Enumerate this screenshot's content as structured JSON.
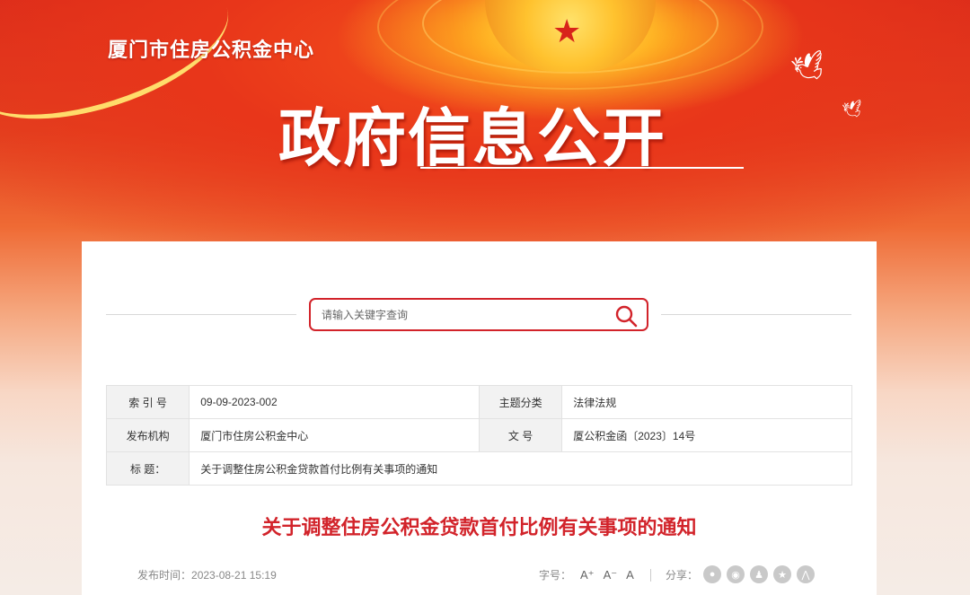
{
  "header": {
    "org_title": "厦门市住房公积金中心",
    "main_title": "政府信息公开"
  },
  "search": {
    "placeholder": "请输入关键字查询"
  },
  "meta_table": {
    "index_label": "索 引 号",
    "index_value": "09-09-2023-002",
    "topic_label": "主题分类",
    "topic_value": "法律法规",
    "issuer_label": "发布机构",
    "issuer_value": "厦门市住房公积金中心",
    "docno_label": "文 号",
    "docno_value": "厦公积金函〔2023〕14号",
    "title_label": "标 题：",
    "title_value": "关于调整住房公积金贷款首付比例有关事项的通知"
  },
  "document": {
    "title": "关于调整住房公积金贷款首付比例有关事项的通知",
    "publish_label": "发布时间：",
    "publish_time": "2023-08-21 15:19"
  },
  "toolbar": {
    "font_label": "字号：",
    "font_large": "A⁺",
    "font_medium": "A⁻",
    "font_small": "A",
    "share_label": "分享："
  },
  "colors": {
    "accent_red": "#d2232a",
    "banner_red": "#e2401f",
    "gold": "#ffc22e"
  },
  "icons": [
    "search-icon",
    "wechat-icon",
    "weibo-icon",
    "qq-icon",
    "qzone-icon",
    "douban-icon"
  ]
}
